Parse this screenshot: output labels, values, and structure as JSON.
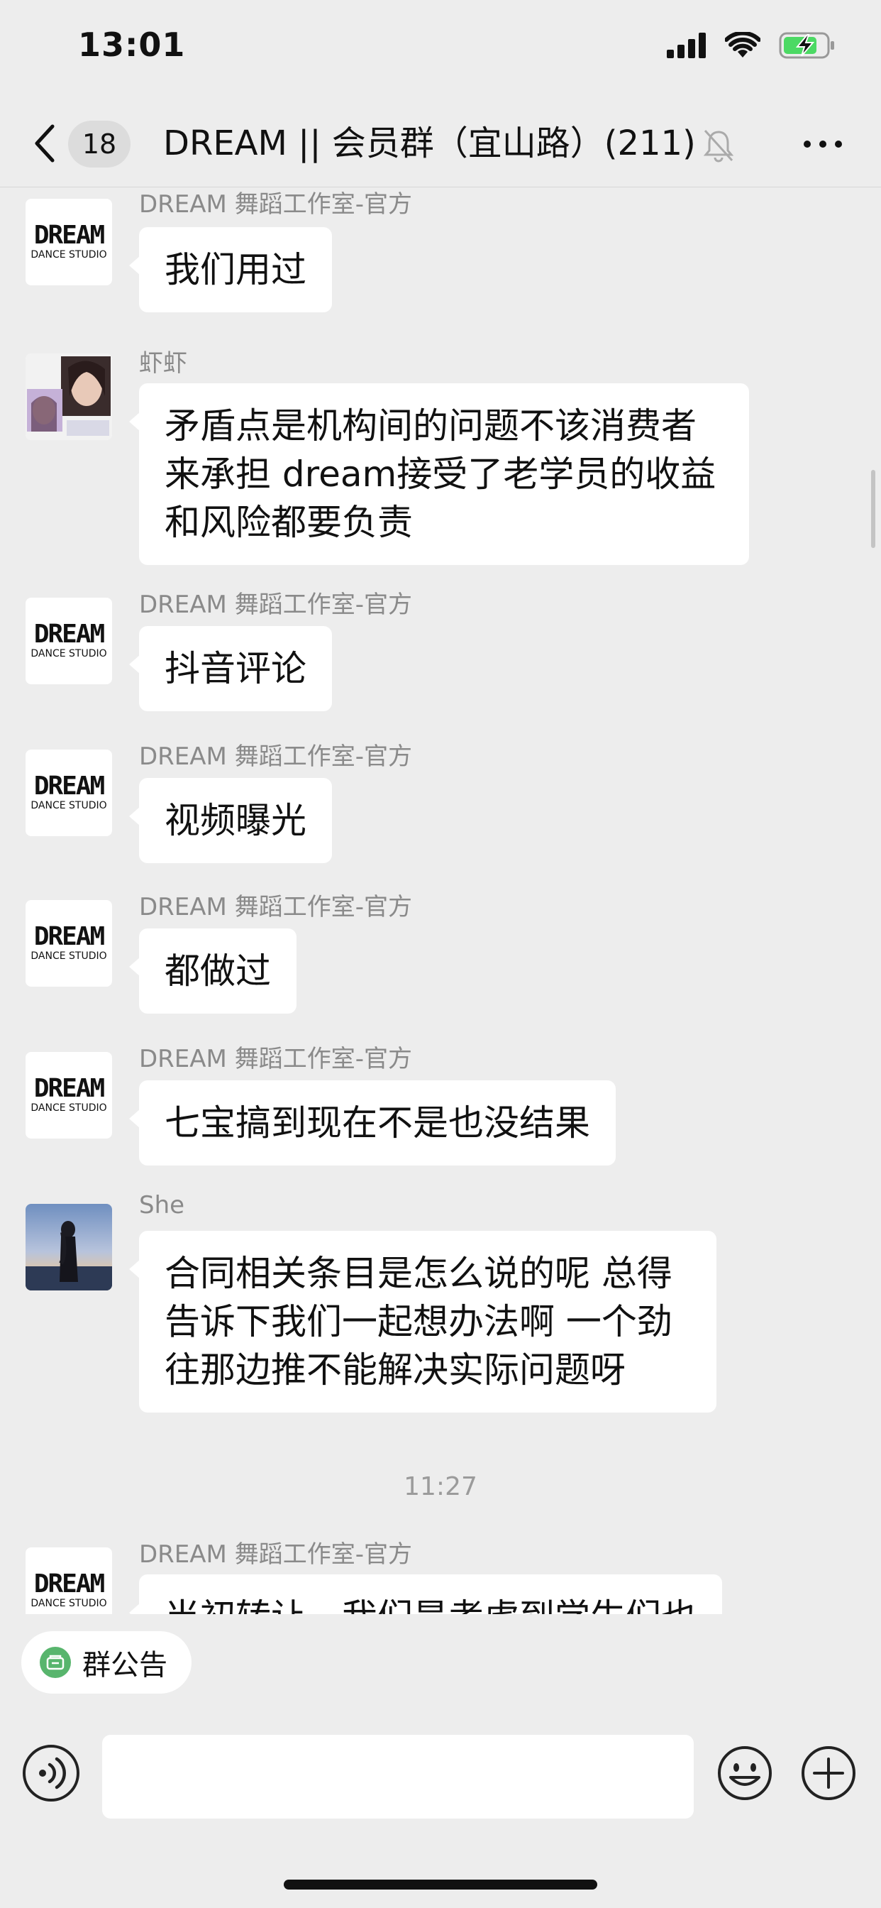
{
  "status": {
    "time": "13:01"
  },
  "nav": {
    "unread_count": "18",
    "title": "DREAM || 会员群（宜山路）(211)"
  },
  "avatars": {
    "dream_logo_main": "DREAM",
    "dream_logo_sub": "DANCE STUDIO"
  },
  "messages": [
    {
      "sender": "DREAM 舞蹈工作室-官方",
      "avatar": "dream-logo",
      "text": "我们用过"
    },
    {
      "sender": "虾虾",
      "avatar": "anime-collage",
      "text": "矛盾点是机构间的问题不该消费者来承担 dream接受了老学员的收益和风险都要负责"
    },
    {
      "sender": "DREAM 舞蹈工作室-官方",
      "avatar": "dream-logo",
      "text": "抖音评论"
    },
    {
      "sender": "DREAM 舞蹈工作室-官方",
      "avatar": "dream-logo",
      "text": "视频曝光"
    },
    {
      "sender": "DREAM 舞蹈工作室-官方",
      "avatar": "dream-logo",
      "text": "都做过"
    },
    {
      "sender": "DREAM 舞蹈工作室-官方",
      "avatar": "dream-logo",
      "text": "七宝搞到现在不是也没结果"
    },
    {
      "sender": "She",
      "avatar": "sunset-photo",
      "text": "合同相关条目是怎么说的呢 总得告诉下我们一起想办法啊 一个劲往那边推不能解决实际问题呀"
    }
  ],
  "timestamp": "11:27",
  "last_message": {
    "sender": "DREAM 舞蹈工作室-官方",
    "avatar": "dream-logo",
    "text": "当初转让，我们是考虑到学生们也"
  },
  "announcement": {
    "label": "群公告"
  },
  "input": {
    "placeholder": ""
  },
  "colors": {
    "background": "#ededed",
    "bubble": "#ffffff",
    "announce_icon": "#58b56d",
    "battery": "#4cd964"
  }
}
